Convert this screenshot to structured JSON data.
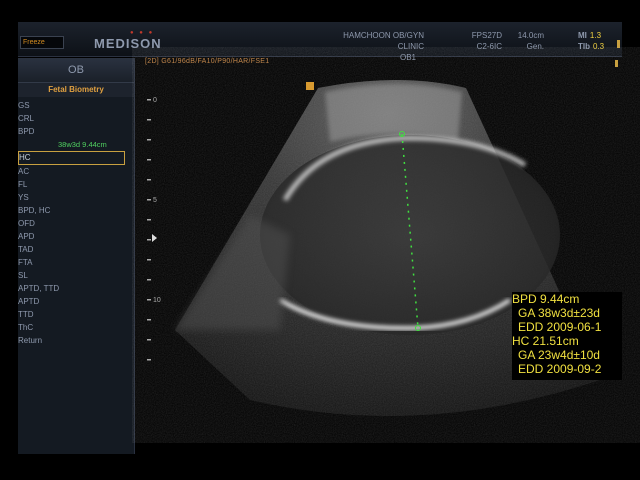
{
  "topbar": {
    "freeze_label": "Freeze",
    "brand": "MEDISON",
    "clinic": "HAMCHOON OB/GYN CLINIC",
    "preset": "OB1",
    "fps": "FPS27D",
    "probe": "C2-6IC",
    "depth": "14.0cm",
    "freq": "Gen.",
    "mi_label": "MI",
    "mi_value": "1.3",
    "tib_label": "TIb",
    "tib_value": "0.3"
  },
  "sidebar": {
    "title": "OB",
    "subtitle": "Fetal Biometry",
    "items": [
      {
        "label": "GS"
      },
      {
        "label": "CRL"
      },
      {
        "label": "BPD"
      },
      {
        "label": "HC"
      },
      {
        "label": "AC"
      },
      {
        "label": "FL"
      },
      {
        "label": "YS"
      },
      {
        "label": "BPD, HC"
      },
      {
        "label": "OFD"
      },
      {
        "label": "APD"
      },
      {
        "label": "TAD"
      },
      {
        "label": "FTA"
      },
      {
        "label": "SL"
      },
      {
        "label": "APTD, TTD"
      },
      {
        "label": "APTD"
      },
      {
        "label": "TTD"
      },
      {
        "label": "ThC"
      },
      {
        "label": "Return"
      }
    ],
    "bpd_value": "38w3d  9.44cm"
  },
  "image_header": "[2D] G61/96dB/FA10/P90/HAR/FSE1",
  "depth_scale": {
    "labels": [
      "0",
      "5",
      "10"
    ]
  },
  "results": {
    "line1": "BPD 9.44cm",
    "line2": "GA 38w3d±23d",
    "line3": "EDD 2009-06-1",
    "line4": "HC  21.51cm",
    "line5": "GA 23w4d±10d",
    "line6": "EDD 2009-09-2"
  },
  "colors": {
    "measure_caliper": "#40e040",
    "results_text": "#f0e040",
    "accent_orange": "#e0a040"
  }
}
